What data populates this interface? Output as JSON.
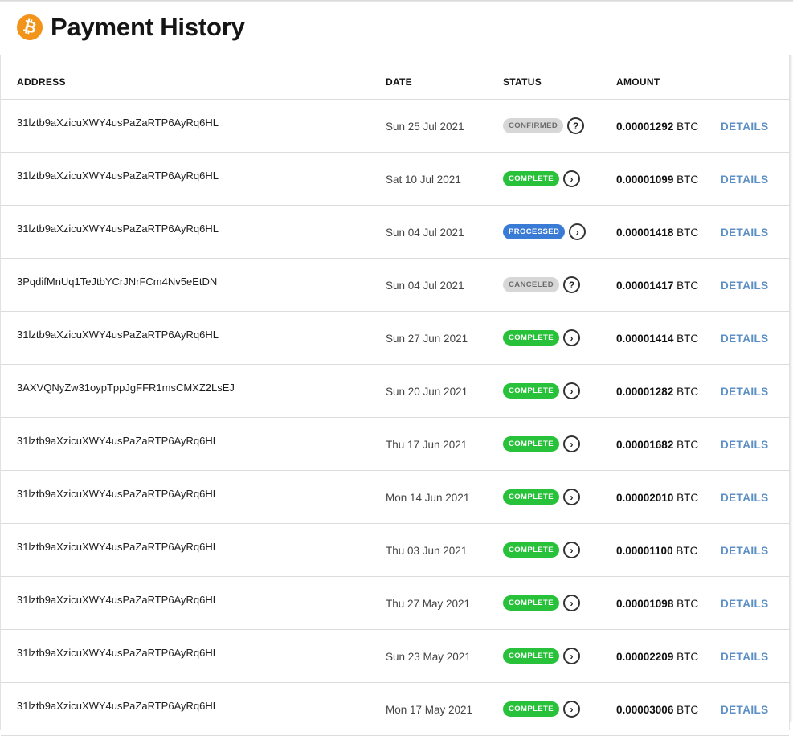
{
  "header": {
    "logo_glyph": "₿",
    "title": "Payment History",
    "logo_color": "#f2931a"
  },
  "table": {
    "columns": {
      "address": "ADDRESS",
      "date": "DATE",
      "status": "STATUS",
      "amount": "AMOUNT"
    },
    "details_label": "DETAILS",
    "currency": "BTC",
    "rows": [
      {
        "address": "31lztb9aXzicuXWY4usPaZaRTP6AyRq6HL",
        "date": "Sun 25 Jul 2021",
        "status": "CONFIRMED",
        "status_type": "confirmed",
        "status_icon": "question-icon",
        "icon_glyph": "?",
        "amount": "0.00001292"
      },
      {
        "address": "31lztb9aXzicuXWY4usPaZaRTP6AyRq6HL",
        "date": "Sat 10 Jul 2021",
        "status": "COMPLETE",
        "status_type": "complete",
        "status_icon": "chevron-right-icon",
        "icon_glyph": "›",
        "amount": "0.00001099"
      },
      {
        "address": "31lztb9aXzicuXWY4usPaZaRTP6AyRq6HL",
        "date": "Sun 04 Jul 2021",
        "status": "PROCESSED",
        "status_type": "processed",
        "status_icon": "chevron-right-icon",
        "icon_glyph": "›",
        "amount": "0.00001418"
      },
      {
        "address": "3PqdifMnUq1TeJtbYCrJNrFCm4Nv5eEtDN",
        "date": "Sun 04 Jul 2021",
        "status": "CANCELED",
        "status_type": "canceled",
        "status_icon": "question-icon",
        "icon_glyph": "?",
        "amount": "0.00001417"
      },
      {
        "address": "31lztb9aXzicuXWY4usPaZaRTP6AyRq6HL",
        "date": "Sun 27 Jun 2021",
        "status": "COMPLETE",
        "status_type": "complete",
        "status_icon": "chevron-right-icon",
        "icon_glyph": "›",
        "amount": "0.00001414"
      },
      {
        "address": "3AXVQNyZw31oypTppJgFFR1msCMXZ2LsEJ",
        "date": "Sun 20 Jun 2021",
        "status": "COMPLETE",
        "status_type": "complete",
        "status_icon": "chevron-right-icon",
        "icon_glyph": "›",
        "amount": "0.00001282"
      },
      {
        "address": "31lztb9aXzicuXWY4usPaZaRTP6AyRq6HL",
        "date": "Thu 17 Jun 2021",
        "status": "COMPLETE",
        "status_type": "complete",
        "status_icon": "chevron-right-icon",
        "icon_glyph": "›",
        "amount": "0.00001682"
      },
      {
        "address": "31lztb9aXzicuXWY4usPaZaRTP6AyRq6HL",
        "date": "Mon 14 Jun 2021",
        "status": "COMPLETE",
        "status_type": "complete",
        "status_icon": "chevron-right-icon",
        "icon_glyph": "›",
        "amount": "0.00002010"
      },
      {
        "address": "31lztb9aXzicuXWY4usPaZaRTP6AyRq6HL",
        "date": "Thu 03 Jun 2021",
        "status": "COMPLETE",
        "status_type": "complete",
        "status_icon": "chevron-right-icon",
        "icon_glyph": "›",
        "amount": "0.00001100"
      },
      {
        "address": "31lztb9aXzicuXWY4usPaZaRTP6AyRq6HL",
        "date": "Thu 27 May 2021",
        "status": "COMPLETE",
        "status_type": "complete",
        "status_icon": "chevron-right-icon",
        "icon_glyph": "›",
        "amount": "0.00001098"
      },
      {
        "address": "31lztb9aXzicuXWY4usPaZaRTP6AyRq6HL",
        "date": "Sun 23 May 2021",
        "status": "COMPLETE",
        "status_type": "complete",
        "status_icon": "chevron-right-icon",
        "icon_glyph": "›",
        "amount": "0.00002209"
      },
      {
        "address": "31lztb9aXzicuXWY4usPaZaRTP6AyRq6HL",
        "date": "Mon 17 May 2021",
        "status": "COMPLETE",
        "status_type": "complete",
        "status_icon": "chevron-right-icon",
        "icon_glyph": "›",
        "amount": "0.00003006"
      }
    ]
  },
  "colors": {
    "complete": "#28c23a",
    "processed": "#3a7bd6",
    "muted_badge": "#d7d7d7",
    "details_link": "#5c8fc4"
  }
}
